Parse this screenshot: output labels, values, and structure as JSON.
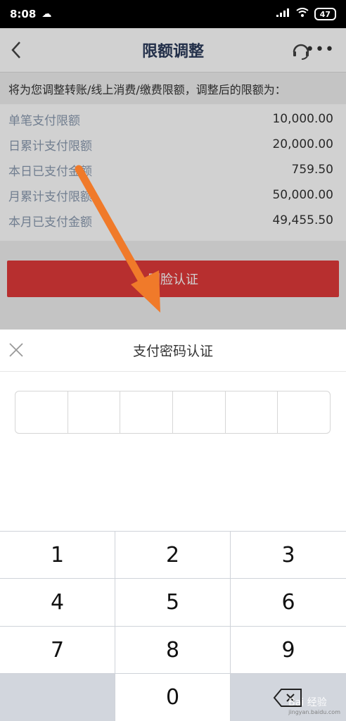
{
  "status_bar": {
    "time": "8:08",
    "battery": "47"
  },
  "navbar": {
    "title": "限额调整"
  },
  "notice": "将为您调整转账/线上消费/缴费限额，调整后的限额为：",
  "limits": [
    {
      "label": "单笔支付限额",
      "value": "10,000.00"
    },
    {
      "label": "日累计支付限额",
      "value": "20,000.00"
    },
    {
      "label": "本日已支付金额",
      "value": "759.50"
    },
    {
      "label": "月累计支付限额",
      "value": "50,000.00"
    },
    {
      "label": "本月已支付金额",
      "value": "49,455.50"
    }
  ],
  "face_button": "刷脸认证",
  "sheet": {
    "title": "支付密码认证"
  },
  "keypad": {
    "k1": "1",
    "k2": "2",
    "k3": "3",
    "k4": "4",
    "k5": "5",
    "k6": "6",
    "k7": "7",
    "k8": "8",
    "k9": "9",
    "k0": "0"
  },
  "watermark": {
    "text": "Bai 经验",
    "sub": "jingyan.baidu.com"
  },
  "colors": {
    "accent_red": "#e03a3a",
    "arrow": "#f07a2a",
    "title_navy": "#2a3a5a"
  }
}
